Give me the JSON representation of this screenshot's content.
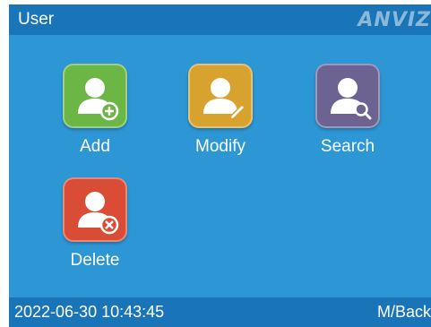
{
  "header": {
    "title": "User",
    "logo": "ANVIZ"
  },
  "tiles": [
    {
      "label": "Add",
      "icon": "user-add-icon",
      "color": "#6cb645"
    },
    {
      "label": "Modify",
      "icon": "user-edit-icon",
      "color": "#d8a22f"
    },
    {
      "label": "Search",
      "icon": "user-search-icon",
      "color": "#6c6393"
    },
    {
      "label": "Delete",
      "icon": "user-delete-icon",
      "color": "#d94d36"
    }
  ],
  "footer": {
    "datetime": "2022-06-30 10:43:45",
    "back_hint": "M/Back"
  }
}
